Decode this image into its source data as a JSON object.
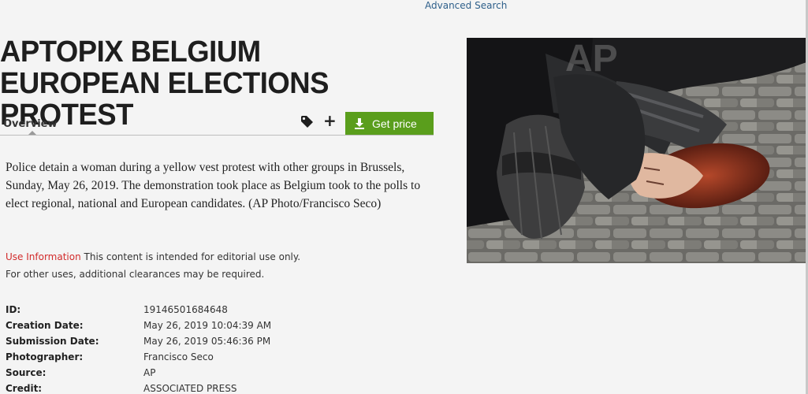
{
  "header": {
    "advanced_search": "Advanced Search"
  },
  "title": "APTOPIX BELGIUM EUROPEAN ELECTIONS PROTEST",
  "tabs": {
    "overview": "Overview"
  },
  "actions": {
    "get_price": "Get price",
    "tag_icon": "tag-icon",
    "plus_icon": "plus-icon",
    "download_icon": "download-icon"
  },
  "colors": {
    "button_green": "#5a9e1c",
    "link_blue": "#2e5f8a",
    "use_info_red": "#d22b2b"
  },
  "caption": "Police detain a woman during a yellow vest protest with other groups in Brussels, Sunday, May 26, 2019. The demonstration took place as Belgium took to the polls to elect regional, national and European candidates. (AP Photo/Francisco Seco)",
  "use_information": {
    "label": "Use Information",
    "text": " This content is intended for editorial use only.",
    "line2": "For other uses, additional clearances may be required."
  },
  "metadata": [
    {
      "label": "ID:",
      "value": "19146501684648"
    },
    {
      "label": "Creation Date:",
      "value": "May 26, 2019 10:04:39 AM"
    },
    {
      "label": "Submission Date:",
      "value": "May 26, 2019 05:46:36 PM"
    },
    {
      "label": "Photographer:",
      "value": "Francisco Seco"
    },
    {
      "label": "Source:",
      "value": "AP"
    },
    {
      "label": "Credit:",
      "value": "ASSOCIATED PRESS"
    }
  ],
  "photo": {
    "watermark": "AP"
  }
}
